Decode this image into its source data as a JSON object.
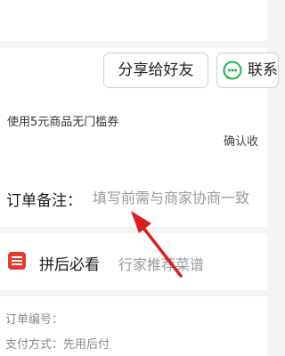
{
  "actions": {
    "share_label": "分享给好友",
    "contact_label": "联系"
  },
  "coupon": {
    "text": "使用5元商品无门槛券"
  },
  "confirm": {
    "text": "确认收"
  },
  "remark": {
    "label": "订单备注：",
    "placeholder": "填写前需与商家协商一致"
  },
  "pin": {
    "label": "拼后必看",
    "description": "行家推荐菜谱"
  },
  "order_info": {
    "order_no_label": "订单编号：",
    "pay_method_label": "支付方式：",
    "pay_method_value": "先用后付"
  },
  "icons": {
    "wechat": "wechat-icon",
    "pin": "note-icon",
    "arrow": "red-arrow-annotation"
  },
  "colors": {
    "accent_red": "#e23a2e",
    "wechat_green": "#22b14c",
    "arrow_red": "#d8201f"
  }
}
